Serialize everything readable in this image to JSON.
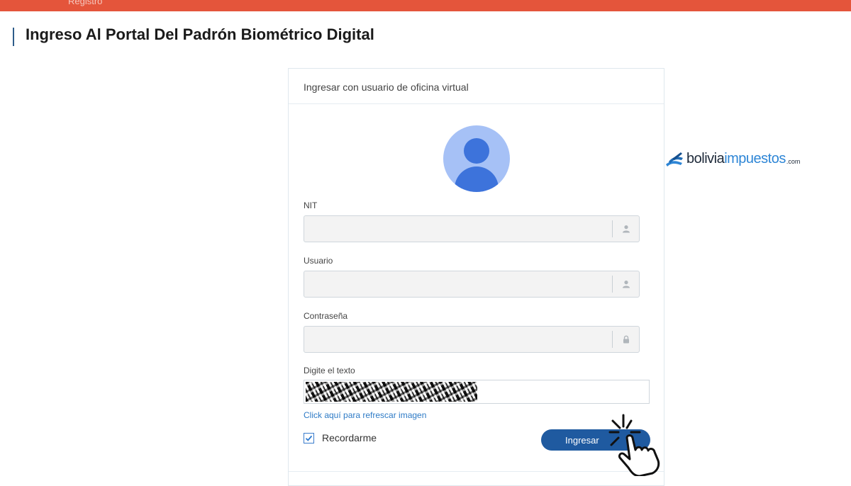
{
  "header": {
    "bar_text": "Registro",
    "page_title": "Ingreso Al Portal Del Padrón Biométrico Digital"
  },
  "card": {
    "title": "Ingresar con usuario de oficina virtual",
    "fields": {
      "nit": {
        "label": "NIT",
        "value": ""
      },
      "usuario": {
        "label": "Usuario",
        "value": ""
      },
      "contrasena": {
        "label": "Contraseña",
        "value": ""
      }
    },
    "captcha": {
      "label": "Digite el texto",
      "value": "",
      "refresh_link": "Click aquí para refrescar imagen"
    },
    "remember": {
      "label": "Recordarme",
      "checked": true
    },
    "submit_label": "Ingresar"
  },
  "logo": {
    "part1": "bolivia",
    "part2": "impuestos",
    "part3": ".com"
  },
  "colors": {
    "top_bar": "#e4553b",
    "primary_button": "#1f5aa0",
    "link": "#2e7bc6",
    "avatar_bg": "#a6c1f6",
    "avatar_fg": "#3d73db"
  }
}
